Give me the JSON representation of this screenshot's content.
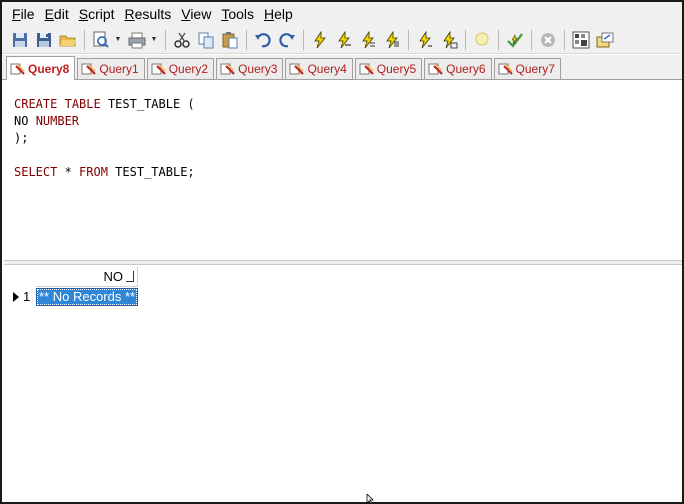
{
  "menu": {
    "items": [
      {
        "underline": "F",
        "rest": "ile"
      },
      {
        "underline": "E",
        "rest": "dit"
      },
      {
        "underline": "S",
        "rest": "cript"
      },
      {
        "underline": "R",
        "rest": "esults"
      },
      {
        "underline": "V",
        "rest": "iew"
      },
      {
        "underline": "T",
        "rest": "ools"
      },
      {
        "underline": "H",
        "rest": "elp"
      }
    ]
  },
  "toolbar": {
    "icons": [
      "new-icon",
      "save-icon",
      "open-icon",
      "preview-icon",
      "print-icon",
      "cut-icon",
      "copy-icon",
      "paste-icon",
      "undo-icon",
      "redo-icon",
      "execute-icon",
      "execute-step-icon",
      "execute-script-icon",
      "execute-all-icon",
      "explain-icon",
      "explain-plan-icon",
      "lightbulb-icon",
      "commit-icon",
      "cancel-icon",
      "grid-icon",
      "export-icon"
    ]
  },
  "tabs": [
    {
      "label": "Query8",
      "active": true
    },
    {
      "label": "Query1",
      "active": false
    },
    {
      "label": "Query2",
      "active": false
    },
    {
      "label": "Query3",
      "active": false
    },
    {
      "label": "Query4",
      "active": false
    },
    {
      "label": "Query5",
      "active": false
    },
    {
      "label": "Query6",
      "active": false
    },
    {
      "label": "Query7",
      "active": false
    }
  ],
  "editor": {
    "line1": {
      "kw1": "CREATE",
      "kw2": "TABLE",
      "rest": " TEST_TABLE ("
    },
    "line2": {
      "ident": "NO ",
      "kw": "NUMBER"
    },
    "line3": ");",
    "line6": {
      "kw1": "SELECT",
      "mid": " * ",
      "kw2": "FROM",
      "rest": " TEST_TABLE;"
    }
  },
  "grid": {
    "column": "NO",
    "row_number": "1",
    "cell": "** No Records **"
  },
  "colors": {
    "keyword": "#800000",
    "selection": "#2e86d6",
    "tab_text": "#c0201e"
  }
}
